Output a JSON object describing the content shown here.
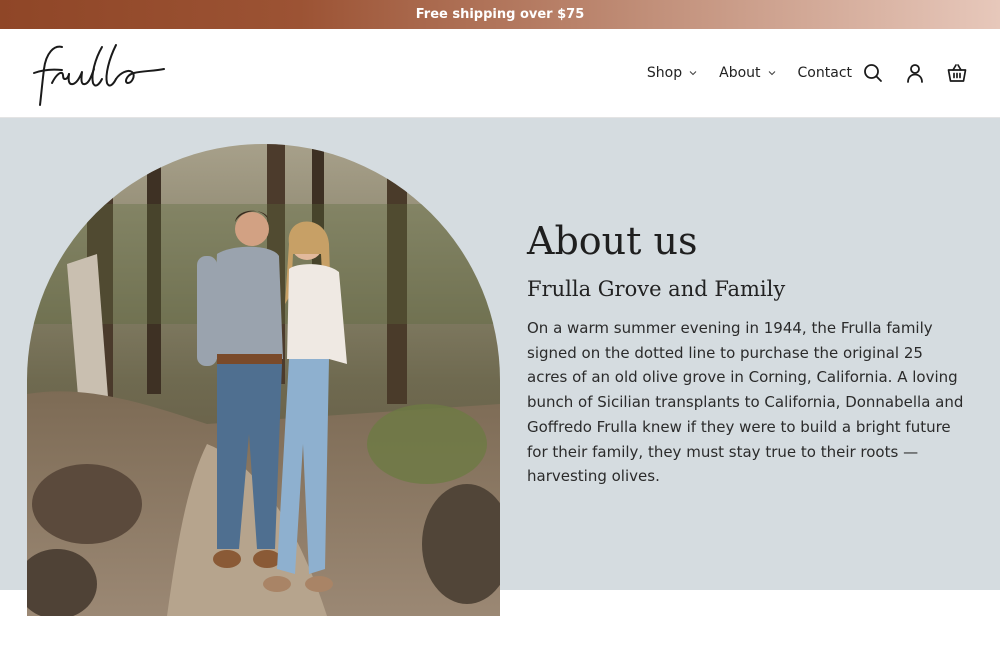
{
  "announcement": {
    "text": "Free shipping over $75"
  },
  "header": {
    "logo_text": "frulla",
    "nav": [
      {
        "label": "Shop",
        "has_dropdown": true
      },
      {
        "label": "About",
        "has_dropdown": true
      },
      {
        "label": "Contact",
        "has_dropdown": false
      }
    ],
    "icons": [
      "search-icon",
      "account-icon",
      "cart-icon"
    ]
  },
  "hero": {
    "title": "About us",
    "subtitle": "Frulla Grove and Family",
    "body": "On a warm summer evening in 1944, the Frulla family signed on the dotted line to purchase the original 25 acres of an old olive grove in Corning, California. A loving bunch of Sicilian transplants to California, Donnabella and Goffredo Frulla knew if they were to build a bright future for their family, they must stay true to their roots — harvesting olives."
  },
  "colors": {
    "announce_dark": "#8f4627",
    "announce_light": "#e7c8bb",
    "hero_bg": "#d5dce0",
    "text": "#222222"
  }
}
